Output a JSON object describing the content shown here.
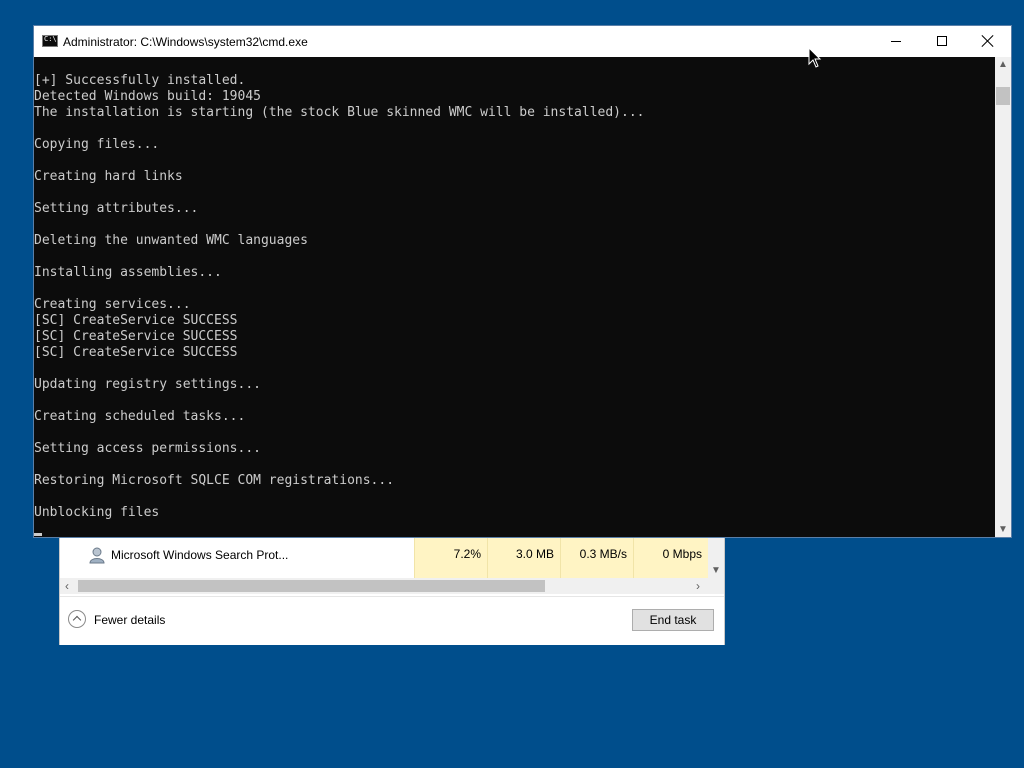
{
  "cmd_window": {
    "title": "Administrator: C:\\Windows\\system32\\cmd.exe",
    "icon": "cmd-icon",
    "controls": {
      "minimize": "minimize-icon",
      "maximize": "maximize-icon",
      "close": "close-icon"
    },
    "console_lines": [
      "[+] Successfully installed.",
      "Detected Windows build: 19045",
      "The installation is starting (the stock Blue skinned WMC will be installed)...",
      "",
      "Copying files...",
      "",
      "Creating hard links",
      "",
      "Setting attributes...",
      "",
      "Deleting the unwanted WMC languages",
      "",
      "Installing assemblies...",
      "",
      "Creating services...",
      "[SC] CreateService SUCCESS",
      "[SC] CreateService SUCCESS",
      "[SC] CreateService SUCCESS",
      "",
      "Updating registry settings...",
      "",
      "Creating scheduled tasks...",
      "",
      "Setting access permissions...",
      "",
      "Restoring Microsoft SQLCE COM registrations...",
      "",
      "Unblocking files"
    ]
  },
  "task_manager": {
    "process_row": {
      "name": "Microsoft Windows Search Prot...",
      "icon": "search-process-icon",
      "cpu": "7.2%",
      "memory": "3.0 MB",
      "disk": "0.3 MB/s",
      "network": "0 Mbps"
    },
    "fewer_details_label": "Fewer details",
    "end_task_label": "End task"
  },
  "colors": {
    "desktop": "#004e8c",
    "console_bg": "#0c0c0c",
    "console_text": "#cccccc",
    "highlight_cell": "#fff4c4"
  }
}
